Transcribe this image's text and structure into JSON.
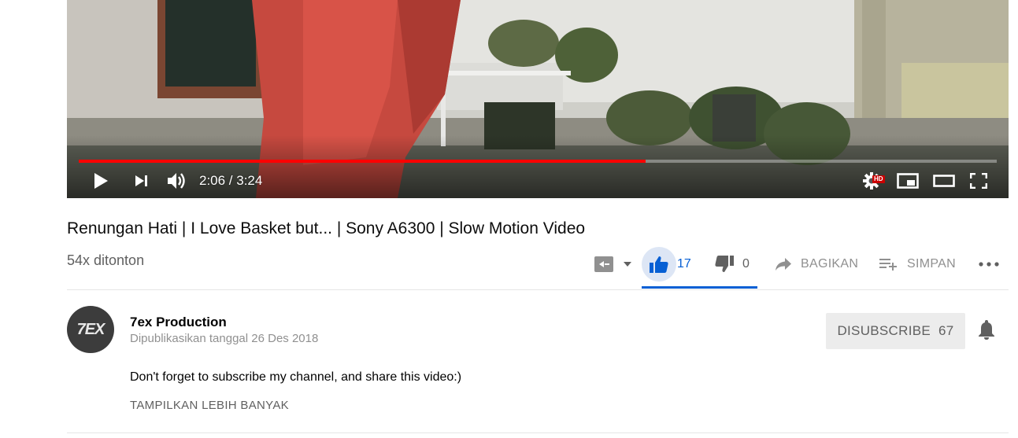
{
  "player": {
    "time_display": "2:06 / 3:24",
    "progress_fraction": 0.6176,
    "progress_color": "#ff0000",
    "hd_badge": "HD",
    "icons": [
      "play-icon",
      "next-icon",
      "volume-icon",
      "settings-icon",
      "miniplayer-icon",
      "theater-mode-icon",
      "fullscreen-icon"
    ]
  },
  "video": {
    "title": "Renungan Hati | I Love Basket but... | Sony A6300 | Slow Motion Video",
    "views": "54x ditonton"
  },
  "actions": {
    "like_count": "17",
    "dislike_count": "0",
    "share_label": "BAGIKAN",
    "save_label": "SIMPAN",
    "accent_color": "#065fd4"
  },
  "owner": {
    "avatar_text": "7EX",
    "channel_name": "7ex Production",
    "publish_date": "Dipublikasikan tanggal 26 Des 2018",
    "subscribe_label": "DISUBSCRIBE",
    "subscriber_count": "67"
  },
  "description": {
    "text": "Don't forget to subscribe my channel, and share this video:)",
    "show_more_label": "TAMPILKAN LEBIH BANYAK"
  }
}
